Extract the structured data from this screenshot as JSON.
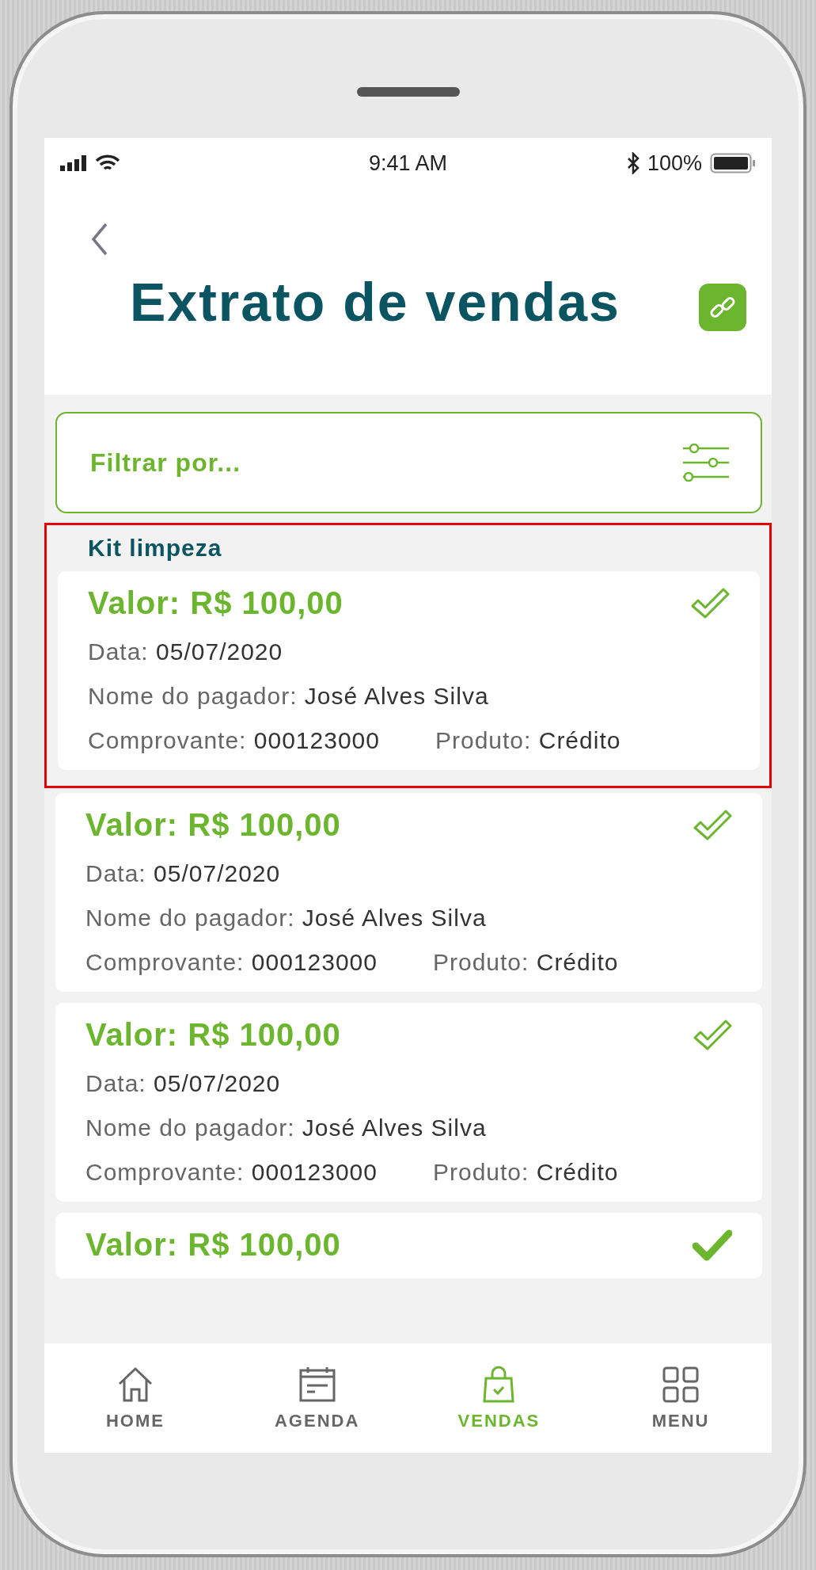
{
  "status_bar": {
    "time": "9:41 AM",
    "battery": "100%"
  },
  "header": {
    "title": "Extrato de vendas"
  },
  "filter": {
    "placeholder": "Filtrar por..."
  },
  "groups": [
    {
      "title": "Kit limpeza",
      "highlighted": true,
      "cards": [
        {
          "value": "Valor: R$ 100,00",
          "confirmed": false,
          "fields": [
            {
              "label": "Data:",
              "value": "05/07/2020"
            },
            {
              "label": "Nome do pagador:",
              "value": "José Alves Silva"
            }
          ],
          "receipt": {
            "label": "Comprovante:",
            "value": "000123000"
          },
          "product": {
            "label": "Produto:",
            "value": "Crédito"
          }
        }
      ]
    },
    {
      "highlighted": false,
      "cards": [
        {
          "value": "Valor: R$ 100,00",
          "confirmed": false,
          "fields": [
            {
              "label": "Data:",
              "value": "05/07/2020"
            },
            {
              "label": "Nome do pagador:",
              "value": "José Alves Silva"
            }
          ],
          "receipt": {
            "label": "Comprovante:",
            "value": "000123000"
          },
          "product": {
            "label": "Produto:",
            "value": "Crédito"
          }
        },
        {
          "value": "Valor: R$ 100,00",
          "confirmed": false,
          "fields": [
            {
              "label": "Data:",
              "value": "05/07/2020"
            },
            {
              "label": "Nome do pagador:",
              "value": "José Alves Silva"
            }
          ],
          "receipt": {
            "label": "Comprovante:",
            "value": "000123000"
          },
          "product": {
            "label": "Produto:",
            "value": "Crédito"
          }
        },
        {
          "value": "Valor: R$ 100,00",
          "confirmed": true
        }
      ]
    }
  ],
  "nav": [
    {
      "label": "HOME",
      "kind": "home",
      "selected": false
    },
    {
      "label": "AGENDA",
      "kind": "calendar",
      "selected": false
    },
    {
      "label": "VENDAS",
      "kind": "bag",
      "selected": true
    },
    {
      "label": "MENU",
      "kind": "grid",
      "selected": false
    }
  ]
}
